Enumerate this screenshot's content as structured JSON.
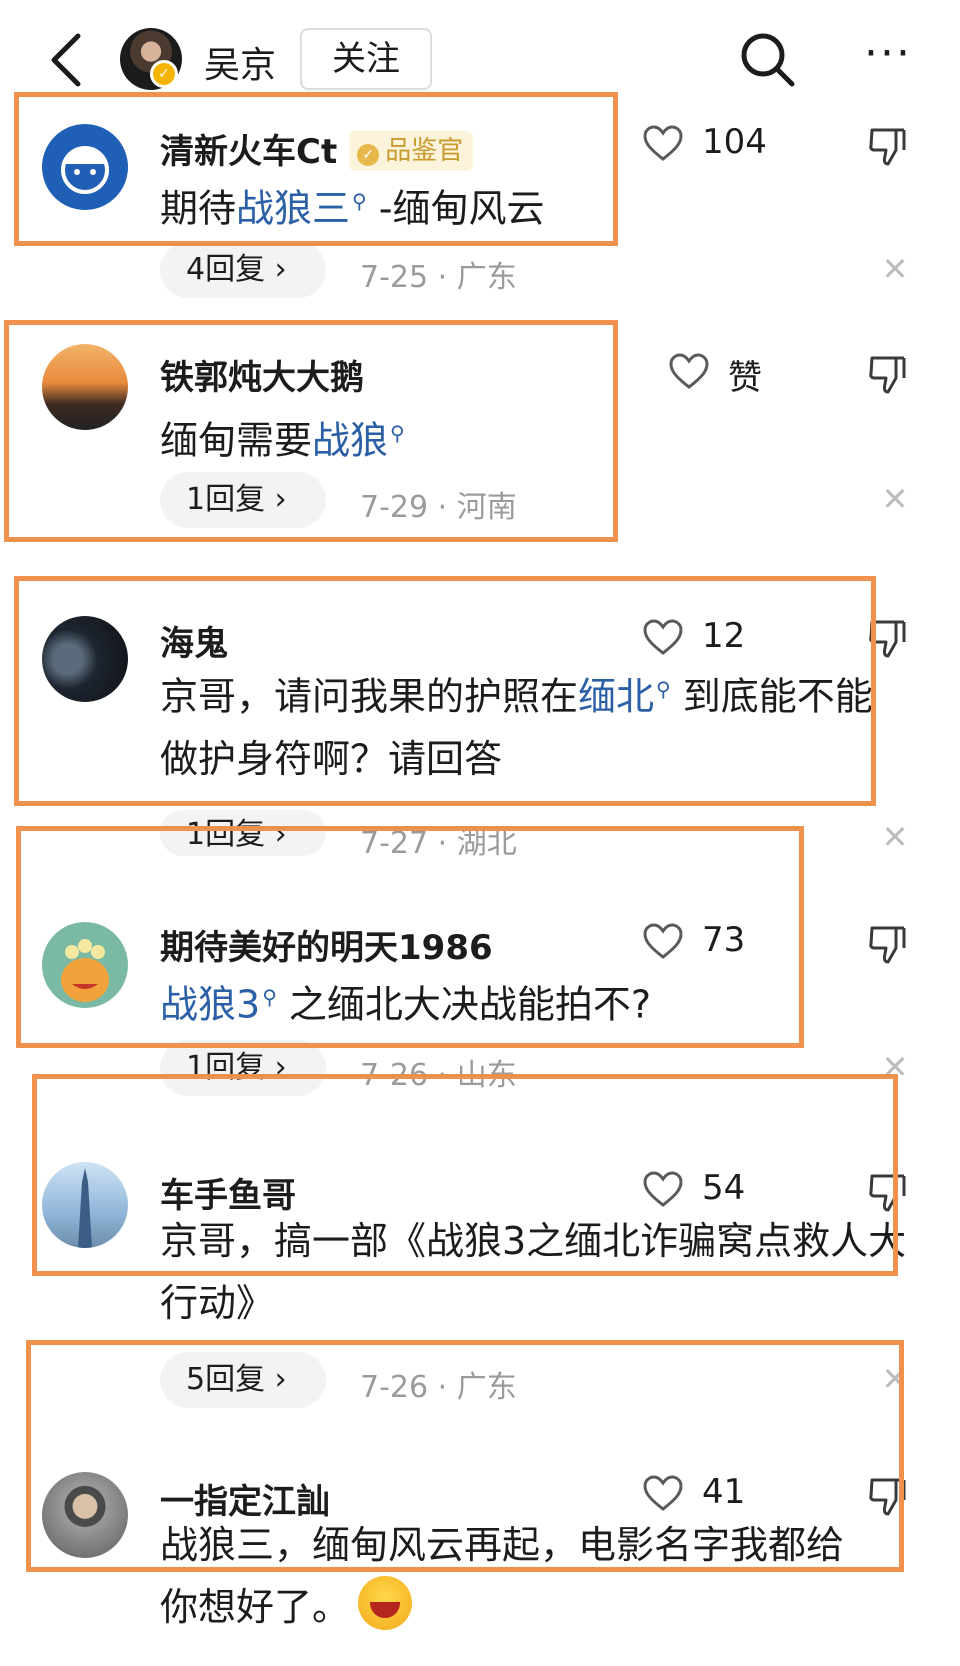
{
  "header": {
    "account_name": "吴京",
    "follow_label": "关注",
    "more_label": "···"
  },
  "comments": [
    {
      "username": "清新火车Ct",
      "badge": "品鉴官",
      "text_before": "期待",
      "highlight": "战狼三",
      "text_after": " -缅甸风云",
      "likes": "104",
      "replies": "4回复 ›",
      "date_location": "7-25 · 广东"
    },
    {
      "username": "铁郭炖大大鹅",
      "text_before": "缅甸需要",
      "highlight": "战狼",
      "text_after": "",
      "likes": "赞",
      "replies": "1回复 ›",
      "date_location": "7-29 · 河南"
    },
    {
      "username": "海鬼",
      "text_before": "京哥，请问我果的护照在",
      "highlight": "缅北",
      "text_after": " 到底能不能做护身符啊？请回答",
      "likes": "12",
      "replies": "1回复 ›",
      "date_location": "7-27 · 湖北"
    },
    {
      "username": "期待美好的明天1986",
      "text_before": "",
      "highlight": "战狼3",
      "text_after": " 之缅北大决战能拍不?",
      "likes": "73",
      "replies": "1回复 ›",
      "date_location": "7-26 · 山东"
    },
    {
      "username": "车手鱼哥",
      "text_before": "京哥，搞一部《战狼3之缅北诈骗窝点救人大行动》",
      "likes": "54",
      "replies": "5回复 ›",
      "date_location": "7-26 · 广东"
    },
    {
      "username": "一指定江訕",
      "text_before": "战狼三，缅甸风云再起，电影名字我都给你想好了。",
      "likes": "41"
    }
  ],
  "colors": {
    "highlight_frame": "#f0924b",
    "link_blue": "#2b5fa6",
    "meta_gray": "#9b9b9b"
  }
}
